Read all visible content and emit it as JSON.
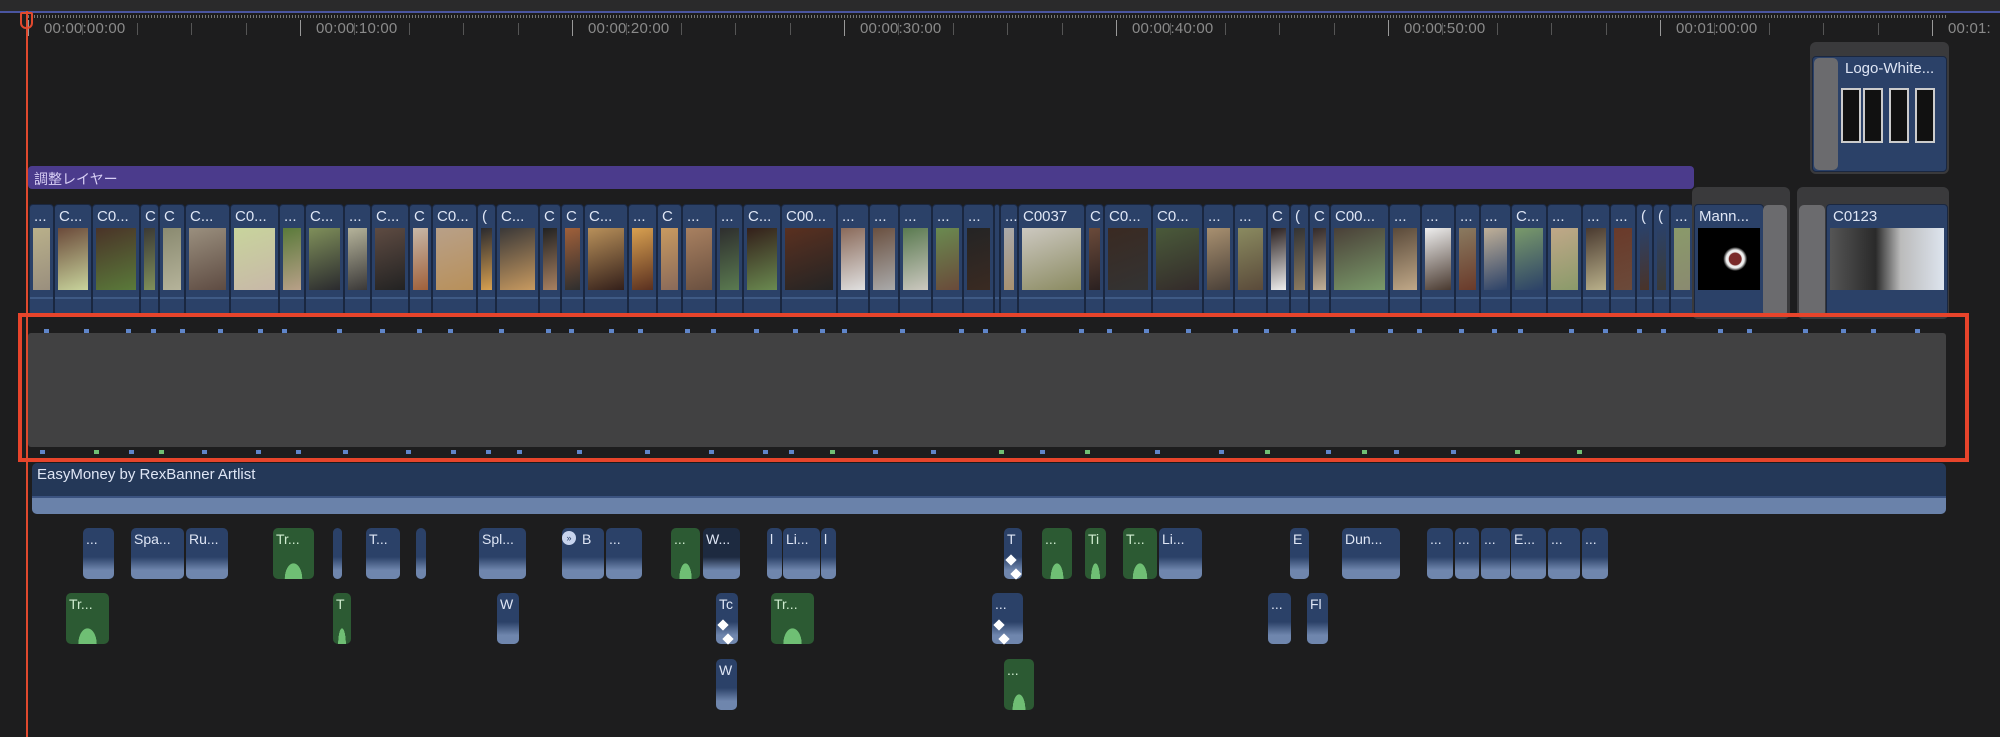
{
  "ruler": {
    "timecodes": [
      "00:00:00:00",
      "00:00:10:00",
      "00:00:20:00",
      "00:00:30:00",
      "00:00:40:00",
      "00:00:50:00",
      "00:01:00:00",
      "00:01:"
    ]
  },
  "adjustment_layer": {
    "label": "調整レイヤー"
  },
  "connected_title": {
    "label": "Logo-White..."
  },
  "primary_clips": [
    "...",
    "C...",
    "C0...",
    "C",
    "C",
    "C...",
    "C0...",
    "...",
    "C...",
    "...",
    "C...",
    "C",
    "C0...",
    "(",
    "C...",
    "C",
    "C",
    "C...",
    "...",
    "C",
    "...",
    "...",
    "C...",
    "C00...",
    "...",
    "...",
    "...",
    "...",
    "...",
    "...",
    "...",
    "C0037",
    "C",
    "C0...",
    "C0...",
    "...",
    "...",
    "C",
    "(",
    "C",
    "C00...",
    "...",
    "...",
    "...",
    "...",
    "C...",
    "...",
    "...",
    "...",
    "(",
    "(",
    "..."
  ],
  "end_clips": {
    "mann": "Mann...",
    "c0123": "C0123"
  },
  "music": {
    "label": "EasyMoney by RexBanner Artlist"
  },
  "audio_clips": {
    "row1": [
      "...",
      "Spa...",
      "Ru...",
      "Tr...",
      "",
      "T...",
      "",
      "Spl...",
      "B",
      "...",
      "...",
      "W...",
      "l",
      "Li...",
      "l",
      "T",
      "...",
      "Ti",
      "T...",
      "Li...",
      "E",
      "Dun...",
      "...",
      "...",
      "...",
      "E...",
      "...",
      "..."
    ],
    "row2": [
      "Tr...",
      "T",
      "W",
      "Tc",
      "Tr...",
      "...",
      "...",
      "Fl"
    ],
    "row3": [
      "W",
      "..."
    ]
  },
  "colors": {
    "playhead": "#e0492e",
    "selection": "#e7442b",
    "adjustment": "#4b3b8c",
    "clip": "#2b4168",
    "audio_green": "#2c5a33"
  }
}
